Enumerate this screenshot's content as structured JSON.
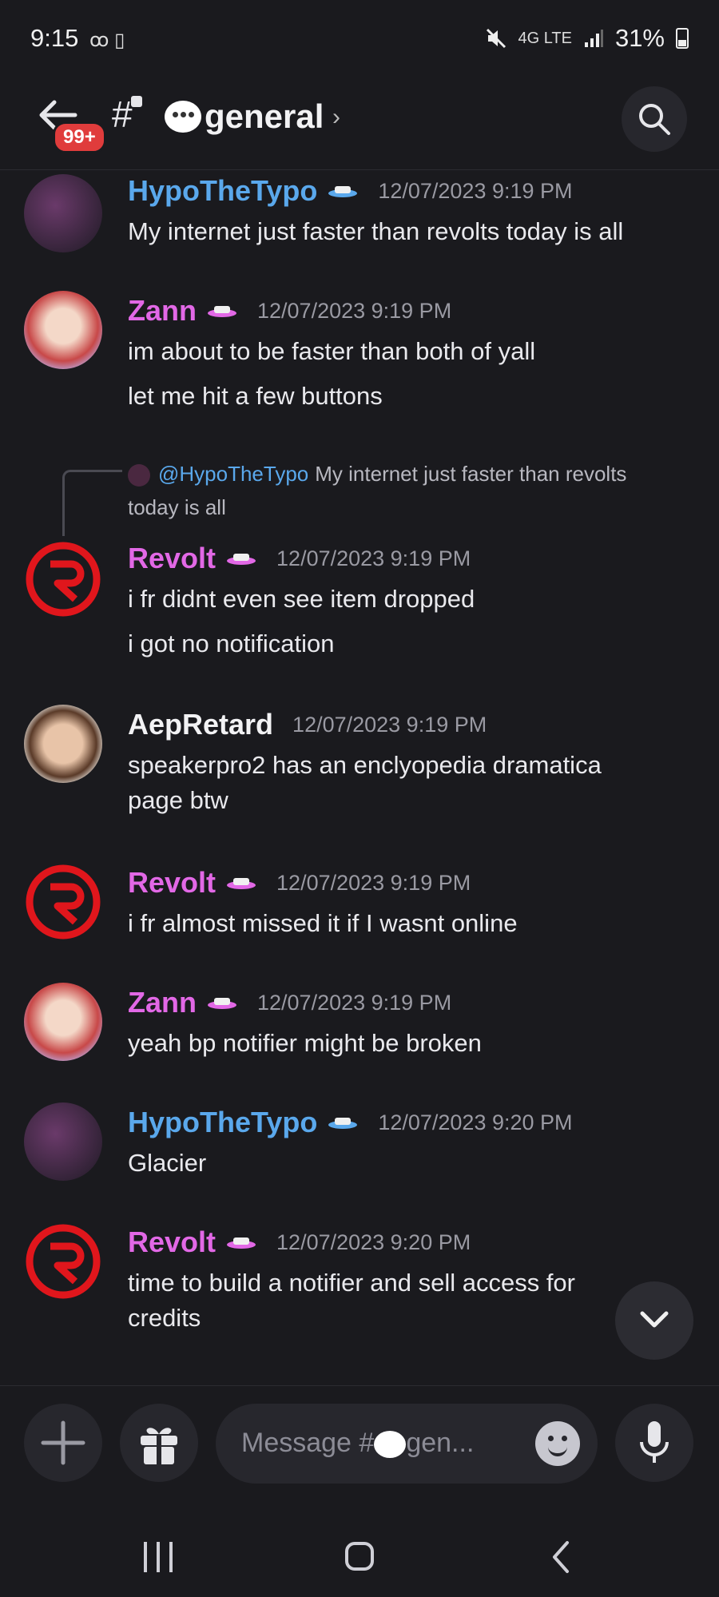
{
  "status_bar": {
    "time": "9:15",
    "left_icons": "ꝏ ▯",
    "network": "4G LTE",
    "battery": "31%"
  },
  "header": {
    "unread_badge": "99+",
    "hash": "#",
    "channel_name": "general",
    "chevron": "›"
  },
  "messages": [
    {
      "user": "HypoTheTypo",
      "timestamp": "12/07/2023 9:19 PM",
      "lines": [
        "My internet just faster than revolts today is all"
      ]
    },
    {
      "user": "Zann",
      "timestamp": "12/07/2023 9:19 PM",
      "lines": [
        "im about to be faster than both of yall",
        "let me hit a few buttons"
      ]
    },
    {
      "user": "Revolt",
      "timestamp": "12/07/2023 9:19 PM",
      "reply_mention": "@HypoTheTypo",
      "reply_text": "My internet just faster than revolts today is all",
      "lines": [
        "i fr didnt even see item dropped",
        "i got no notification"
      ]
    },
    {
      "user": "AepRetard",
      "timestamp": "12/07/2023 9:19 PM",
      "lines": [
        "speakerpro2 has an enclyopedia dramatica page btw"
      ]
    },
    {
      "user": "Revolt",
      "timestamp": "12/07/2023 9:19 PM",
      "lines": [
        "i fr almost missed it if I wasnt online"
      ]
    },
    {
      "user": "Zann",
      "timestamp": "12/07/2023 9:19 PM",
      "lines": [
        "yeah bp notifier might be broken"
      ]
    },
    {
      "user": "HypoTheTypo",
      "timestamp": "12/07/2023 9:20 PM",
      "lines": [
        "Glacier"
      ]
    },
    {
      "user": "Revolt",
      "timestamp": "12/07/2023 9:20 PM",
      "lines": [
        "time to build a notifier and sell access for credits"
      ]
    }
  ],
  "composer": {
    "placeholder_prefix": "Message #",
    "placeholder_suffix": "gen..."
  },
  "colors": {
    "background": "#1a1a1e",
    "username_blue": "#5aa8ec",
    "username_pink": "#e268e6",
    "badge_red": "#e03c3c",
    "revolt_red": "#e0161c"
  },
  "icons": [
    "back-arrow-icon",
    "search-icon",
    "nitro-hat-icon",
    "plus-icon",
    "gift-icon",
    "emoji-icon",
    "microphone-icon",
    "chevron-down-icon"
  ]
}
